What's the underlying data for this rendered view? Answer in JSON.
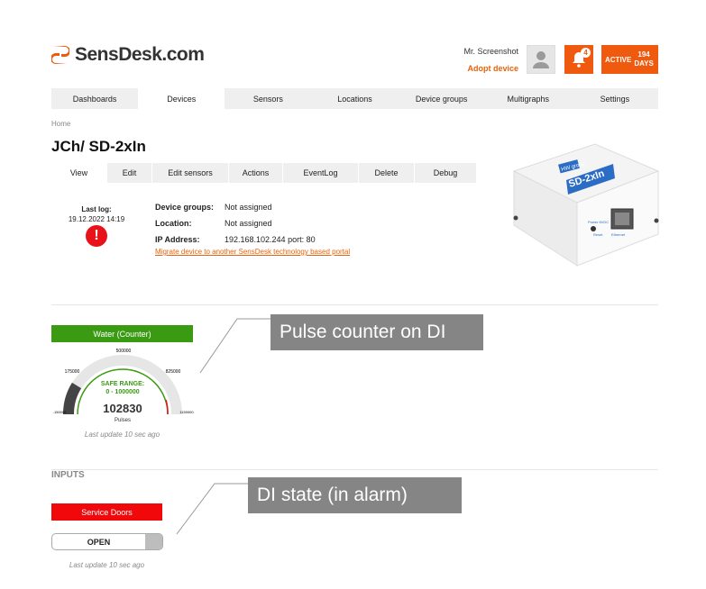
{
  "brand": {
    "name": "SensDesk.com"
  },
  "user": {
    "name": "Mr. Screenshot",
    "adopt_link": "Adopt device"
  },
  "notifications": {
    "count": "4"
  },
  "active": {
    "label": "ACTIVE",
    "days_value": "194",
    "days_label": "DAYS"
  },
  "nav": {
    "items": [
      "Dashboards",
      "Devices",
      "Sensors",
      "Locations",
      "Device groups",
      "Multigraphs",
      "Settings"
    ],
    "active_index": 1
  },
  "breadcrumb": "Home",
  "device": {
    "title": "JCh/ SD-2xIn",
    "tabs": [
      "View",
      "Edit",
      "Edit sensors",
      "Actions",
      "EventLog",
      "Delete",
      "Debug"
    ],
    "last_log_label": "Last log:",
    "last_log_value": "19.12.2022 14:19",
    "groups_label": "Device groups:",
    "groups_value": "Not assigned",
    "location_label": "Location:",
    "location_value": "Not assigned",
    "ip_label": "IP Address:",
    "ip_value": "192.168.102.244 port: 80",
    "migrate_link": "Migrate device to another SensDesk technology based portal",
    "image_labels": {
      "brand": "HW group",
      "model": "SD-2xIn",
      "port": "Ethernet",
      "power": "Power 6VDC",
      "reset": "Reset"
    }
  },
  "sensor": {
    "name": "Water (Counter)",
    "gauge": {
      "safe_range_label": "SAFE RANGE:",
      "safe_range": "0 - 1000000",
      "value": "102830",
      "unit": "Pulses",
      "ticks": [
        "500000",
        "175000",
        "825000",
        "-150000",
        "1150000"
      ]
    },
    "last_update": "Last update 10 sec ago"
  },
  "callouts": {
    "pulse": "Pulse counter on DI",
    "di": "DI state (in alarm)"
  },
  "inputs": {
    "header": "INPUTS",
    "name": "Service Doors",
    "state": "OPEN",
    "last_update": "Last update 10 sec ago"
  },
  "colors": {
    "accent": "#f05a0e",
    "ok": "#3a9a12",
    "alarm": "#f0080a"
  }
}
